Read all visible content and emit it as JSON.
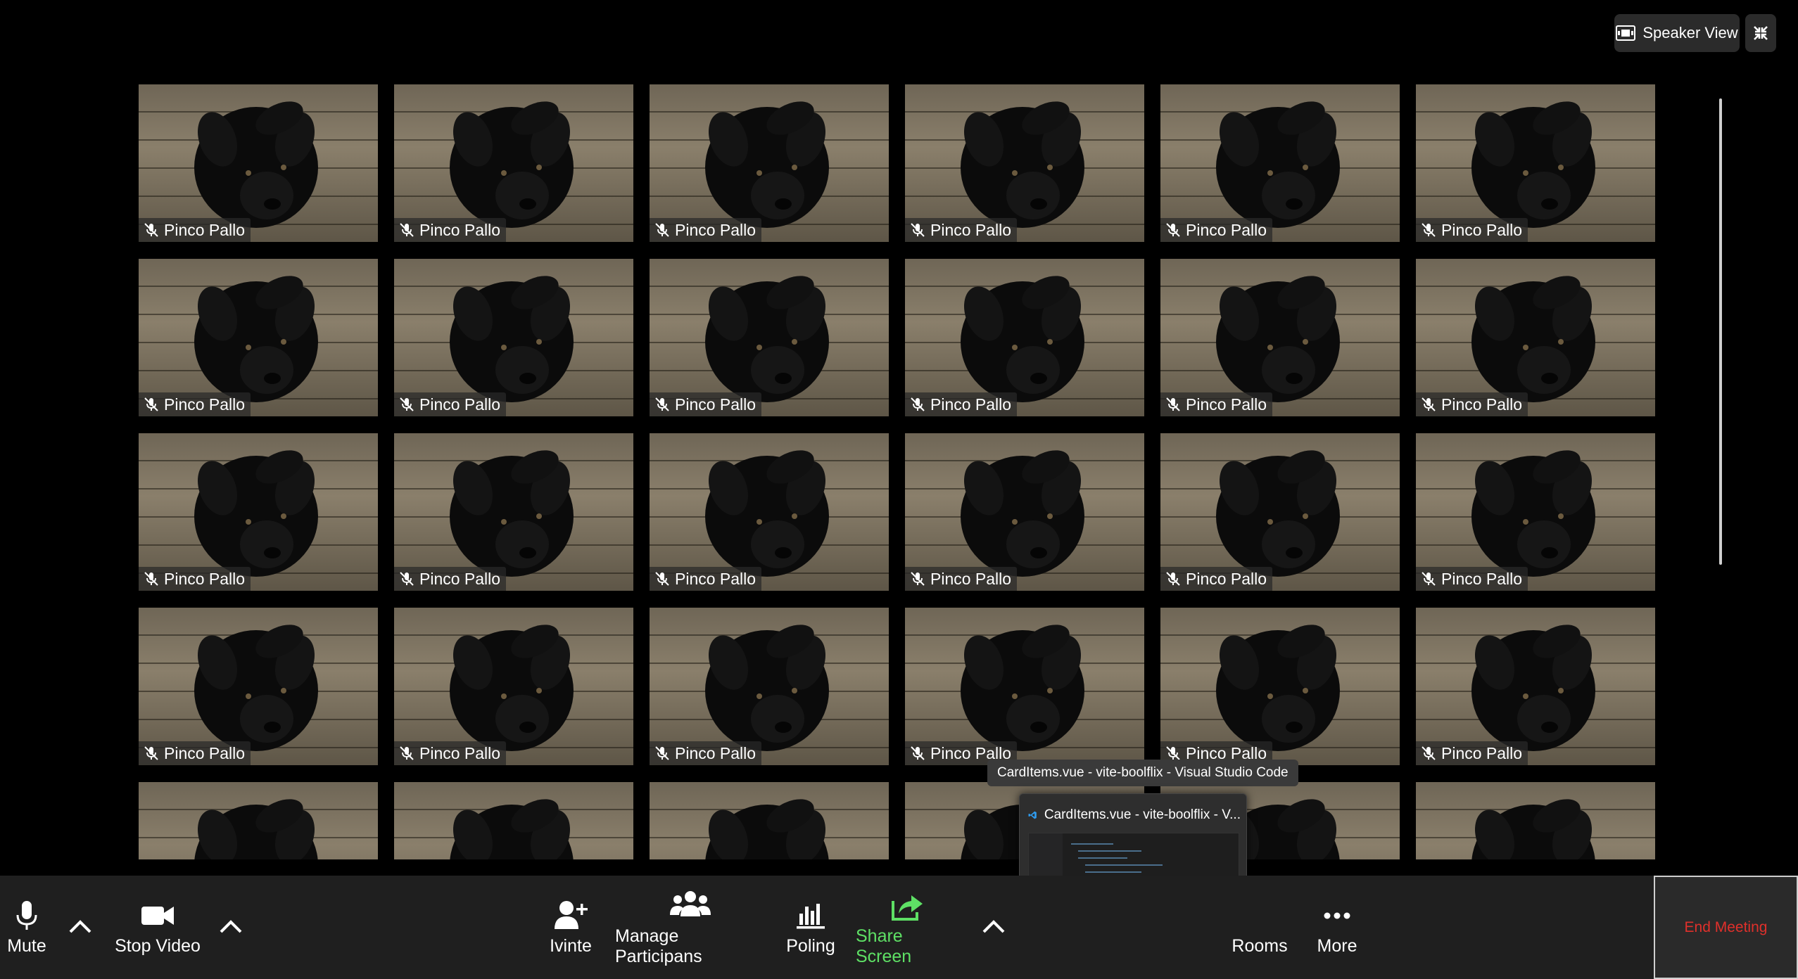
{
  "top_controls": {
    "speaker_view_label": "Speaker View"
  },
  "participants": {
    "name": "Pinco Pallo",
    "muted": true,
    "rows": 5,
    "columns": 6
  },
  "tooltip": {
    "text": "CardItems.vue - vite-boolflix - Visual Studio Code"
  },
  "preview": {
    "title": "CardItems.vue - vite-boolflix - V..."
  },
  "toolbar": {
    "mute_label": "Mute",
    "stop_video_label": "Stop Video",
    "invite_label": "Ivinte",
    "manage_label": "Manage Participans",
    "polling_label": "Poling",
    "share_label": "Share Screen",
    "rooms_label": "Rooms",
    "more_label": "More",
    "end_label": "End Meeting"
  },
  "colors": {
    "share_accent": "#5ee065",
    "end_text": "#e0302b",
    "toolbar_bg": "#1f1f1f"
  }
}
